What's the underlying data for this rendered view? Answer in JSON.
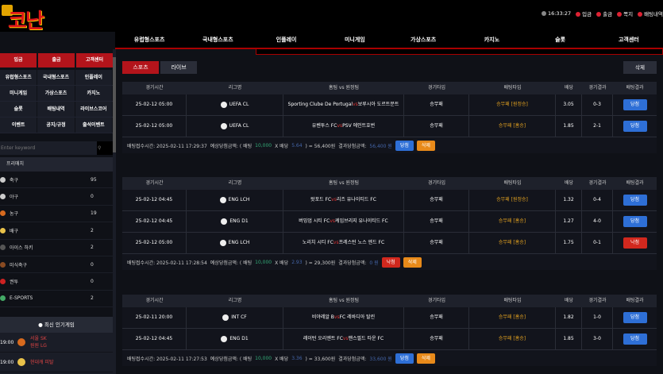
{
  "header": {
    "logo_text": "코난",
    "time": "16:33:27",
    "util_links": [
      "입금",
      "출금",
      "쪽지",
      "배팅내역"
    ]
  },
  "nav": {
    "items": [
      "유럽형스포츠",
      "국내형스포츠",
      "인플레이",
      "미니게임",
      "가상스포츠",
      "카지노",
      "슬롯",
      "고객센터"
    ]
  },
  "sidebar": {
    "buttons": [
      "입금",
      "출금",
      "고객센터"
    ],
    "menu_rows": [
      [
        "유럽형스포츠",
        "국내형스포츠",
        "인플레이"
      ],
      [
        "미니게임",
        "가상스포츠",
        "카지노"
      ],
      [
        "슬롯",
        "배팅내역",
        "라이브스코어"
      ],
      [
        "이벤트",
        "공지/규정",
        "출석이벤트"
      ]
    ],
    "search_placeholder": "Enter keyword",
    "sports_header": "프리매치",
    "sports": [
      {
        "name": "축구",
        "count": "95"
      },
      {
        "name": "야구",
        "count": "0"
      },
      {
        "name": "농구",
        "count": "19"
      },
      {
        "name": "배구",
        "count": "2"
      },
      {
        "name": "아이스 하키",
        "count": "2"
      },
      {
        "name": "미식축구",
        "count": "0"
      },
      {
        "name": "권투",
        "count": "0"
      },
      {
        "name": "E-SPORTS",
        "count": "2"
      }
    ],
    "popular_header": "최신 인기게임",
    "popular": [
      {
        "time": "19:00",
        "team1": "서울 SK",
        "team2": "원원 LG"
      },
      {
        "time": "19:00",
        "team1": "현대캐 피탈",
        "team2": ""
      }
    ]
  },
  "main": {
    "tabs": [
      "스포츠",
      "라이브"
    ],
    "delete_all": "삭제",
    "columns": [
      "경기시간",
      "리그명",
      "홈팀 vs 원정팀",
      "경기타입",
      "배팅타입",
      "배당",
      "경기결과",
      "배팅결과"
    ],
    "bets": [
      {
        "rows": [
          {
            "time": "25-02-12 05:00",
            "league": "UEFA CL",
            "home": "Sporting Clube De Portugal",
            "away": "보루시아 도르트문트",
            "type": "승무패",
            "pick": "승무패 [원정승]",
            "odds": "3.05",
            "score": "0-3",
            "result": "당첨",
            "status": "win"
          },
          {
            "time": "25-02-12 05:00",
            "league": "UEFA CL",
            "home": "유벤투스 FC",
            "away": "PSV 에인트호번",
            "type": "승무패",
            "pick": "승무패 [홈승]",
            "odds": "1.85",
            "score": "2-1",
            "result": "당첨",
            "status": "win"
          }
        ],
        "footer": {
          "label": "배팅접수시간: 2025-02-11 17:29:37",
          "expected_label": "예상당첨금액: ( 배팅",
          "stake": "10,000",
          "x": "X 배당",
          "odds": "5.64",
          "eq": ") = 56,400원",
          "actual_label": "결과당첨금액:",
          "actual": "56,400 원",
          "badge": "당첨",
          "badge_status": "win",
          "delete": "삭제"
        }
      },
      {
        "rows": [
          {
            "time": "25-02-12 04:45",
            "league": "ENG LCH",
            "home": "왓포드 FC",
            "away": "리즈 유나이티드 FC",
            "type": "승무패",
            "pick": "승무패 [원정승]",
            "odds": "1.32",
            "score": "0-4",
            "result": "당첨",
            "status": "win"
          },
          {
            "time": "25-02-12 04:45",
            "league": "ENG D1",
            "home": "버밍엄 시티 FC",
            "away": "케임브리지 유나이티드 FC",
            "type": "승무패",
            "pick": "승무패 [홈승]",
            "odds": "1.27",
            "score": "4-0",
            "result": "당첨",
            "status": "win"
          },
          {
            "time": "25-02-12 05:00",
            "league": "ENG LCH",
            "home": "노리치 시티 FC",
            "away": "프레스턴 노스 엔드 FC",
            "type": "승무패",
            "pick": "승무패 [홈승]",
            "odds": "1.75",
            "score": "0-1",
            "result": "낙첨",
            "status": "lose"
          }
        ],
        "footer": {
          "label": "배팅접수시간: 2025-02-11 17:28:54",
          "expected_label": "예상당첨금액: ( 배팅",
          "stake": "10,000",
          "x": "X 배당",
          "odds": "2.93",
          "eq": ") = 29,300원",
          "actual_label": "결과당첨금액:",
          "actual": "0 원",
          "badge": "낙첨",
          "badge_status": "lose",
          "delete": "삭제"
        }
      },
      {
        "rows": [
          {
            "time": "25-02-11 20:00",
            "league": "INT CF",
            "home": "비야레알 B",
            "away": "FC 레바디아 탈린",
            "type": "승무패",
            "pick": "승무패 [홈승]",
            "odds": "1.82",
            "score": "1-0",
            "result": "당첨",
            "status": "win"
          },
          {
            "time": "25-02-12 04:45",
            "league": "ENG D1",
            "home": "레이턴 오리엔트 FC",
            "away": "맨스필드 타운 FC",
            "type": "승무패",
            "pick": "승무패 [홈승]",
            "odds": "1.85",
            "score": "3-0",
            "result": "당첨",
            "status": "win"
          }
        ],
        "footer": {
          "label": "배팅접수시간: 2025-02-11 17:27:53",
          "expected_label": "예상당첨금액: ( 배팅",
          "stake": "10,000",
          "x": "X 배당",
          "odds": "3.36",
          "eq": ") = 33,600원",
          "actual_label": "결과당첨금액:",
          "actual": "33,600 원",
          "badge": "당첨",
          "badge_status": "win",
          "delete": "삭제"
        }
      }
    ]
  }
}
